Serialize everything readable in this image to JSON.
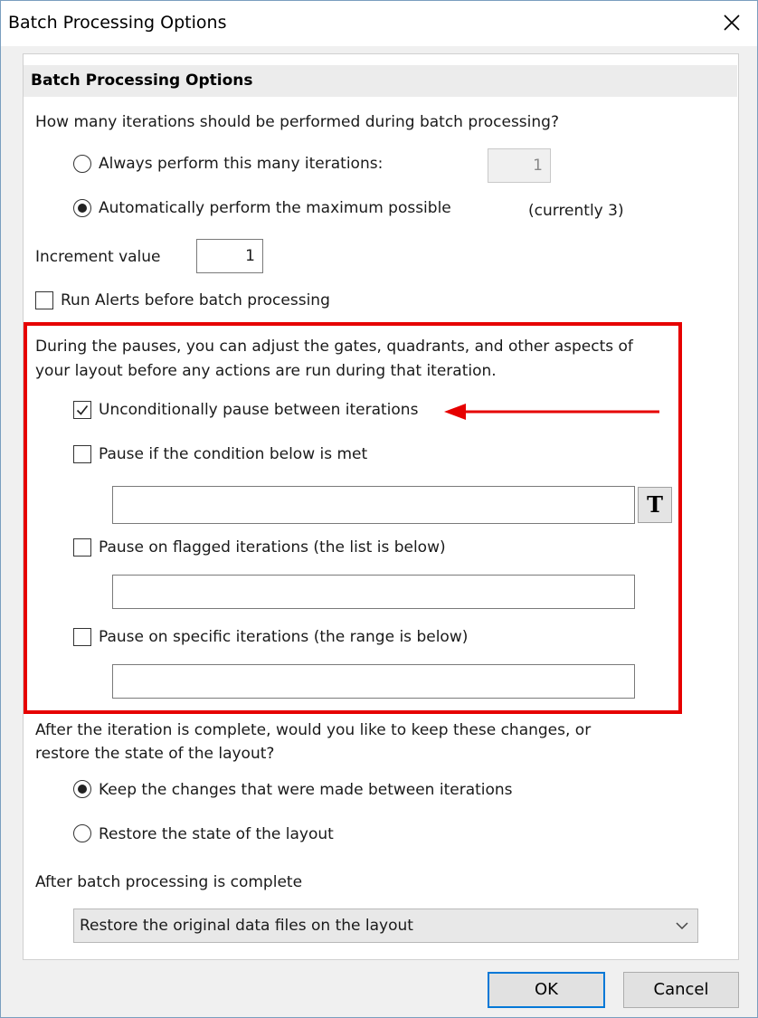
{
  "window": {
    "title": "Batch Processing Options"
  },
  "section": {
    "header": "Batch Processing Options"
  },
  "iterations": {
    "question": "How many iterations should be performed during batch processing?",
    "option_fixed": "Always perform this many iterations:",
    "option_fixed_value": "1",
    "option_max": "Automatically perform the maximum possible",
    "currently": "(currently 3)",
    "selected": "option_max"
  },
  "increment": {
    "label": "Increment value",
    "value": "1"
  },
  "run_alerts": {
    "label": "Run Alerts before batch processing",
    "checked": false
  },
  "pauses": {
    "description_line1": "During the pauses, you can adjust the gates, quadrants, and other aspects of",
    "description_line2": "your layout before any actions are run during that iteration.",
    "unconditional": {
      "label": "Unconditionally pause between iterations",
      "checked": true
    },
    "condition": {
      "label": "Pause if the condition below is met",
      "checked": false,
      "value": "",
      "button_label": "T"
    },
    "flagged": {
      "label": "Pause on flagged iterations (the list is below)",
      "checked": false,
      "value": ""
    },
    "specific": {
      "label": "Pause on specific iterations (the range is below)",
      "checked": false,
      "value": ""
    }
  },
  "after_iteration": {
    "question_line1": "After the iteration is complete, would you like to keep these changes, or",
    "question_line2": "restore the state of the layout?",
    "option_keep": "Keep the changes that were made between iterations",
    "option_restore": "Restore the state of the layout",
    "selected": "option_keep"
  },
  "after_batch": {
    "label": "After batch processing is complete",
    "selected_value": "Restore the original data files on the layout"
  },
  "footer": {
    "ok_label": "OK",
    "cancel_label": "Cancel"
  },
  "colors": {
    "highlight": "#e60000",
    "accent": "#0078d7"
  },
  "icons": {
    "close": "close-icon",
    "checkmark": "checkmark-icon",
    "dropdown": "chevron-down-icon",
    "arrow": "arrow-left-annotation"
  }
}
